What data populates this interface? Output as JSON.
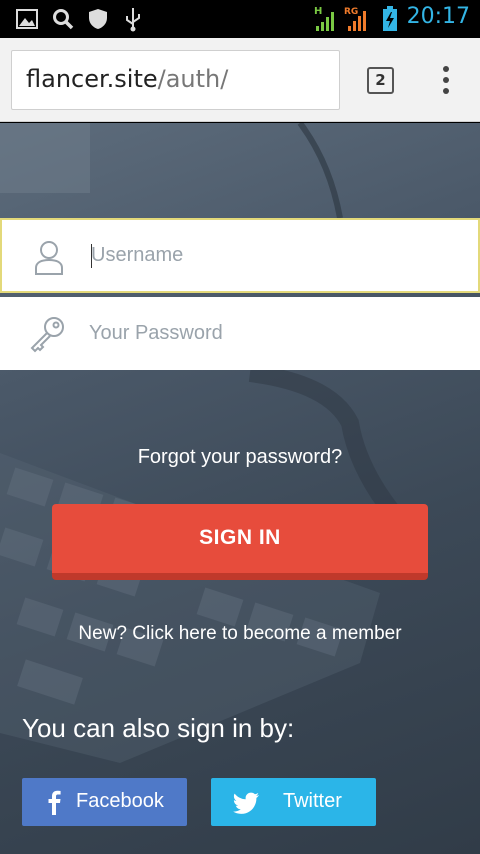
{
  "status_bar": {
    "time": "20:17",
    "icons": [
      "image-icon",
      "search-icon",
      "shield-icon",
      "usb-icon",
      "signal-h-icon",
      "signal-rg-icon",
      "battery-charging-icon"
    ],
    "signal_labels": [
      "H",
      "RG"
    ]
  },
  "browser": {
    "url_host": "flancer.site",
    "url_path": "/auth/",
    "tab_count": "2"
  },
  "login": {
    "username_placeholder": "Username",
    "password_placeholder": "Your Password",
    "forgot_link": "Forgot your password?",
    "sign_in_button": "SIGN IN",
    "new_member_link": "New? Click here to become a member",
    "also_sign_in_text": "You can also sign in by:",
    "facebook_button": "Facebook",
    "twitter_button": "Twitter"
  },
  "colors": {
    "sign_in": "#e74c3c",
    "facebook": "#4f79c8",
    "twitter": "#2bb5e8",
    "status_accent": "#33b5e5",
    "focus_border": "#e3d97a"
  }
}
